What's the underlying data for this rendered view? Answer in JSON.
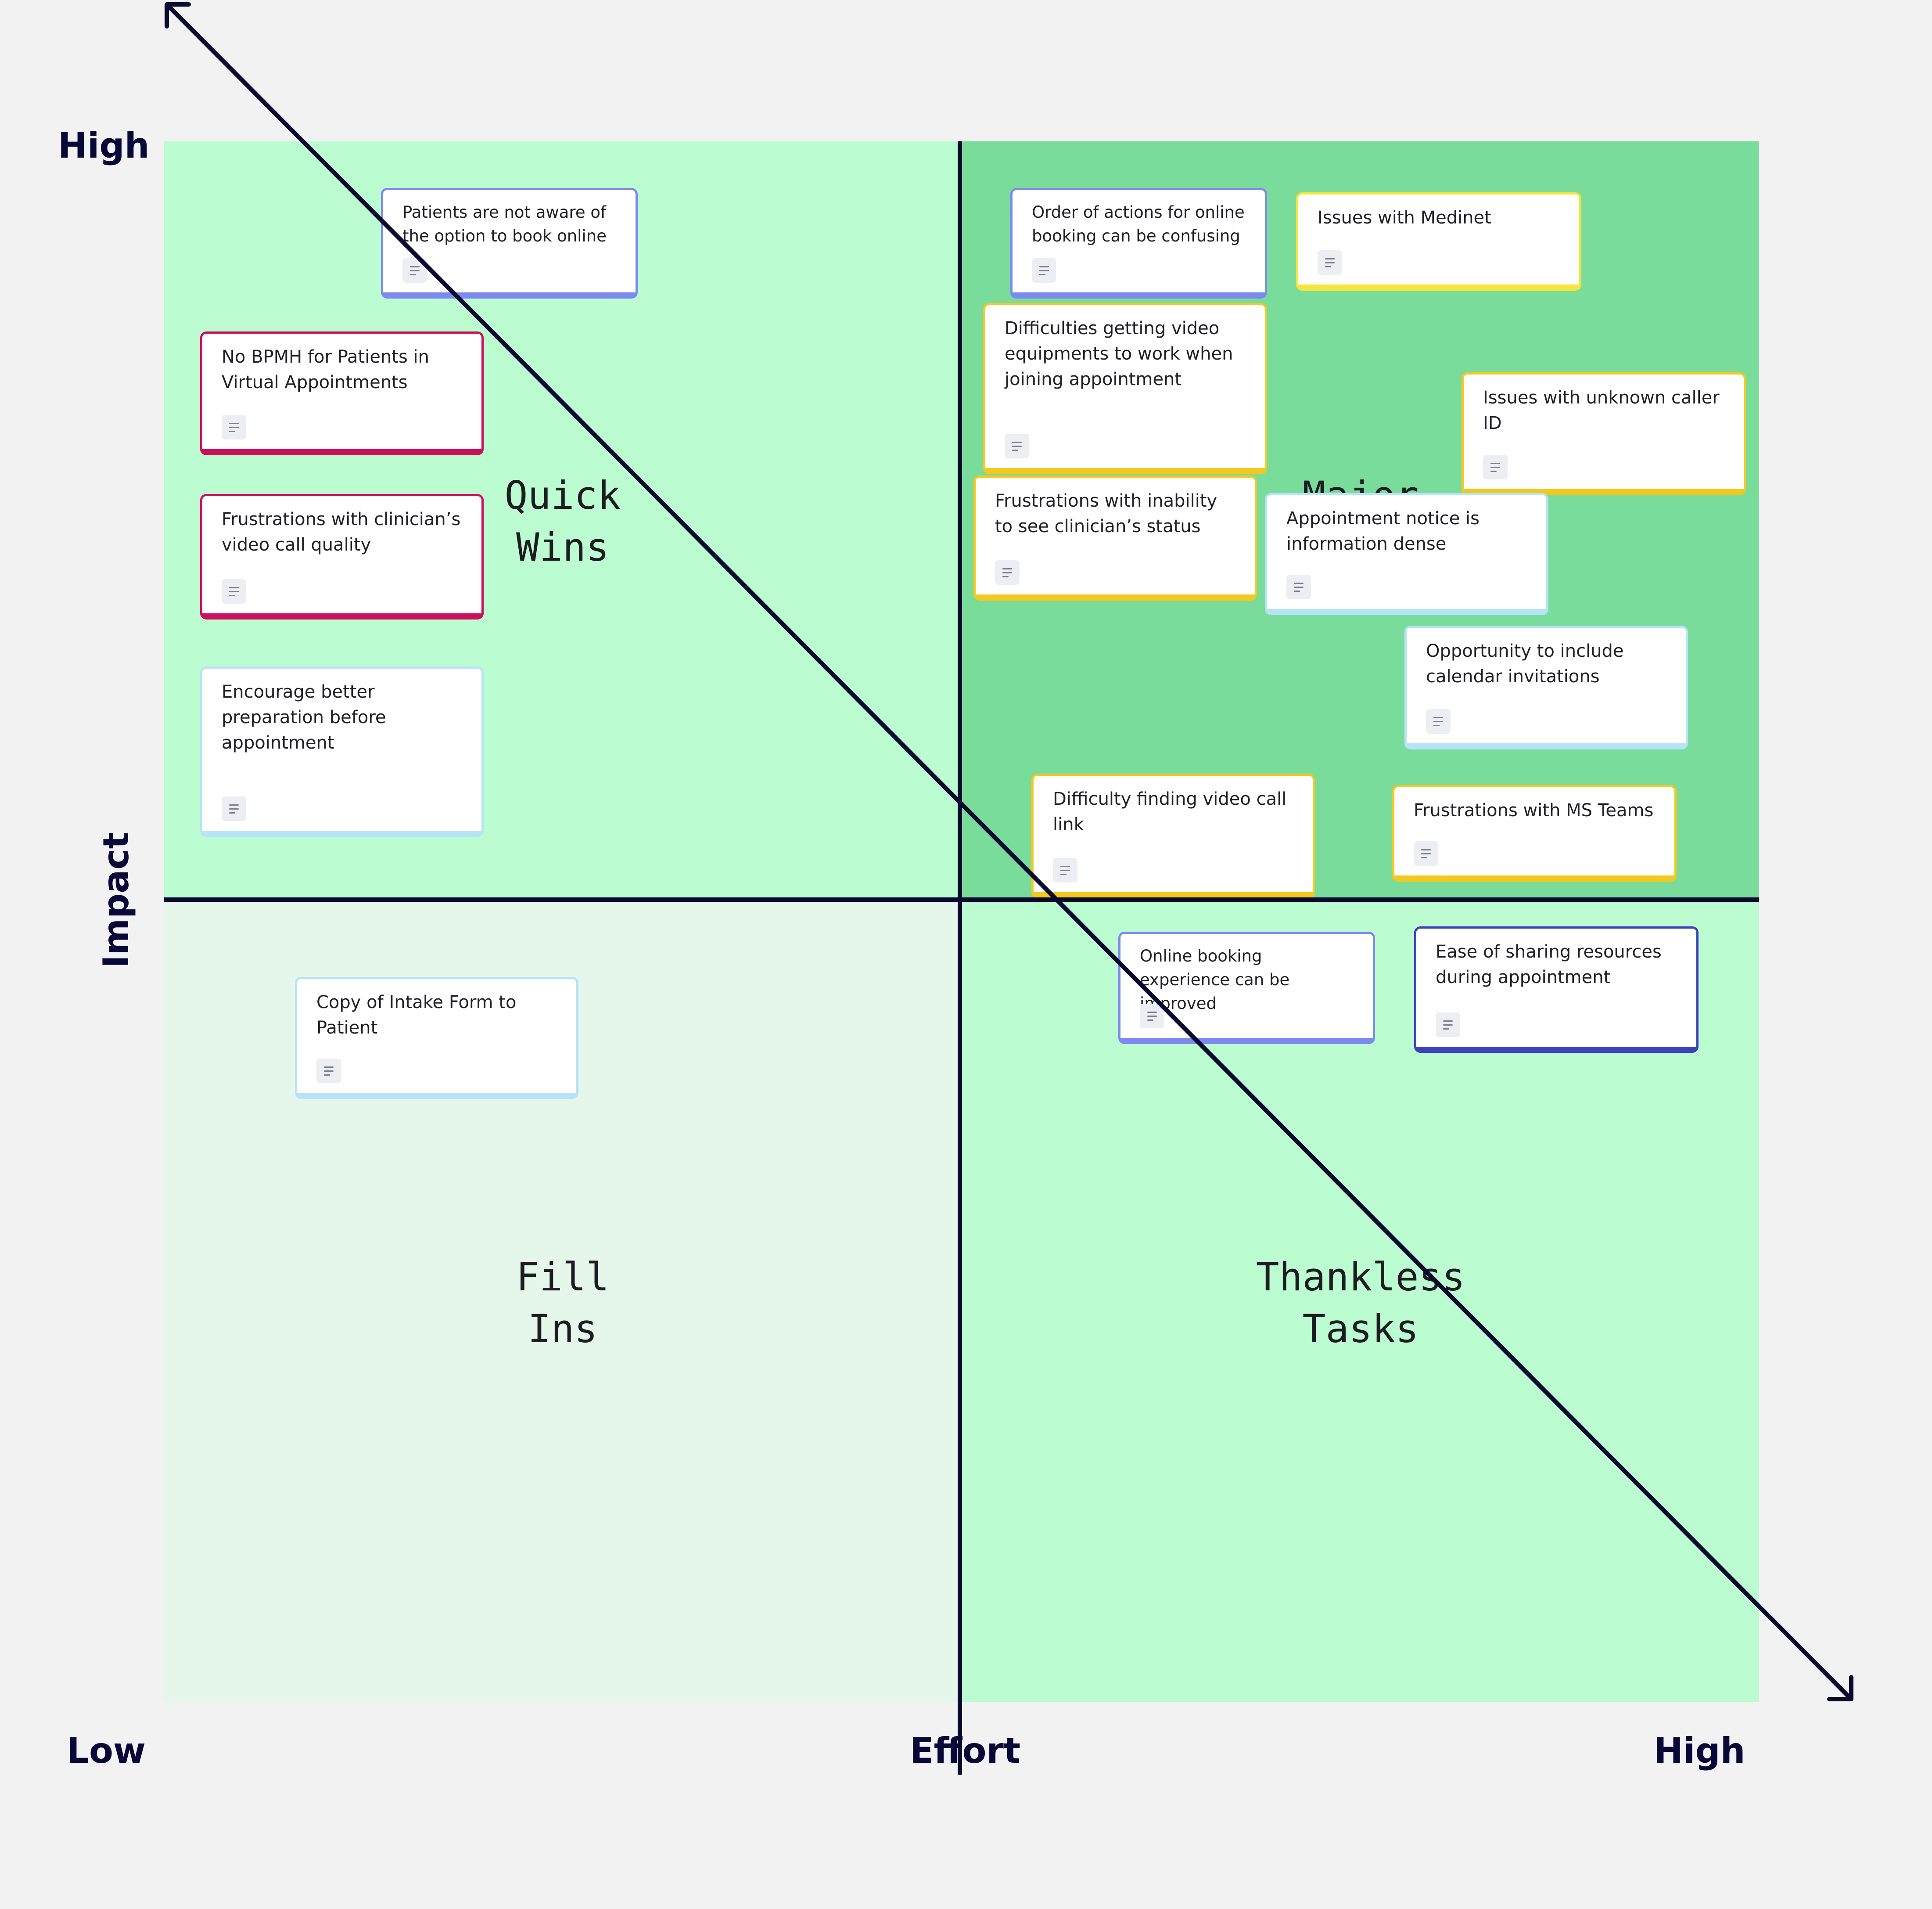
{
  "axes": {
    "y_high": "High",
    "y_label": "Impact",
    "x_low": "Low",
    "x_label": "Effort",
    "x_high": "High"
  },
  "quadrants": {
    "top_left": "Quick\nWins",
    "top_right": "Major",
    "bottom_left": "Fill\nIns",
    "bottom_right": "Thankless\nTasks"
  },
  "colors": {
    "quadrant_bright": "#bbfcd1",
    "quadrant_dark": "#7adc9b",
    "quadrant_light": "#e5f7eb",
    "axis": "#0a0a30",
    "note_blue": "#7c8af0",
    "note_red": "#cc0f5c",
    "note_light_blue": "#b5e4f8",
    "note_yellow": "#f3c920",
    "note_navy": "#3c42b8"
  },
  "notes": [
    {
      "text": "Patients are not aware of the option to book online",
      "color": "blue",
      "icon": "notes-icon"
    },
    {
      "text": "No BPMH for Patients in Virtual Appointments",
      "color": "red",
      "icon": "notes-icon"
    },
    {
      "text": "Frustrations with clinician’s video call quality",
      "color": "red",
      "icon": "notes-icon"
    },
    {
      "text": "Encourage better preparation before appointment",
      "color": "light-blue",
      "icon": "notes-icon"
    },
    {
      "text": "Order of actions for online booking can be confusing",
      "color": "blue",
      "icon": "notes-icon"
    },
    {
      "text": "Issues with Medinet",
      "color": "yellow",
      "icon": "notes-icon"
    },
    {
      "text": "Difficulties getting video equipments to work when joining appointment",
      "color": "yellow",
      "icon": "notes-icon"
    },
    {
      "text": "Issues with unknown caller ID",
      "color": "yellow",
      "icon": "notes-icon"
    },
    {
      "text": "Frustrations with inability to see clinician’s status",
      "color": "yellow",
      "icon": "notes-icon"
    },
    {
      "text": "Appointment notice is information dense",
      "color": "light-blue",
      "icon": "notes-icon"
    },
    {
      "text": "Opportunity to include calendar invitations",
      "color": "light-blue",
      "icon": "notes-icon"
    },
    {
      "text": "Difficulty finding video call link",
      "color": "yellow",
      "icon": "notes-icon"
    },
    {
      "text": "Frustrations with MS Teams",
      "color": "yellow",
      "icon": "notes-icon"
    },
    {
      "text": "Online booking experience can be improved",
      "color": "blue",
      "icon": "notes-icon"
    },
    {
      "text": "Ease of sharing resources during appointment",
      "color": "navy",
      "icon": "notes-icon"
    },
    {
      "text": "Copy of Intake Form to Patient",
      "color": "light-blue",
      "icon": "notes-icon"
    }
  ]
}
